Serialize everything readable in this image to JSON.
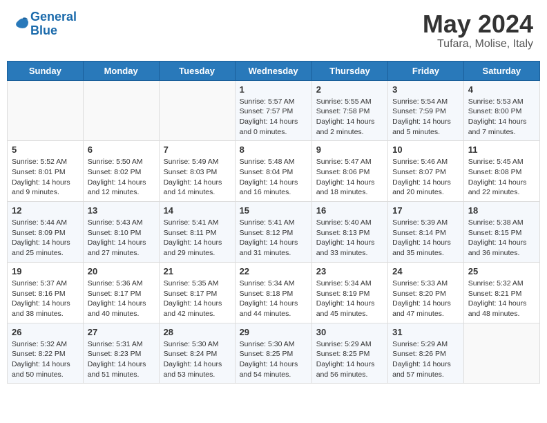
{
  "header": {
    "logo_line1": "General",
    "logo_line2": "Blue",
    "month": "May 2024",
    "location": "Tufara, Molise, Italy"
  },
  "days_of_week": [
    "Sunday",
    "Monday",
    "Tuesday",
    "Wednesday",
    "Thursday",
    "Friday",
    "Saturday"
  ],
  "weeks": [
    [
      {
        "day": "",
        "info": ""
      },
      {
        "day": "",
        "info": ""
      },
      {
        "day": "",
        "info": ""
      },
      {
        "day": "1",
        "info": "Sunrise: 5:57 AM\nSunset: 7:57 PM\nDaylight: 14 hours\nand 0 minutes."
      },
      {
        "day": "2",
        "info": "Sunrise: 5:55 AM\nSunset: 7:58 PM\nDaylight: 14 hours\nand 2 minutes."
      },
      {
        "day": "3",
        "info": "Sunrise: 5:54 AM\nSunset: 7:59 PM\nDaylight: 14 hours\nand 5 minutes."
      },
      {
        "day": "4",
        "info": "Sunrise: 5:53 AM\nSunset: 8:00 PM\nDaylight: 14 hours\nand 7 minutes."
      }
    ],
    [
      {
        "day": "5",
        "info": "Sunrise: 5:52 AM\nSunset: 8:01 PM\nDaylight: 14 hours\nand 9 minutes."
      },
      {
        "day": "6",
        "info": "Sunrise: 5:50 AM\nSunset: 8:02 PM\nDaylight: 14 hours\nand 12 minutes."
      },
      {
        "day": "7",
        "info": "Sunrise: 5:49 AM\nSunset: 8:03 PM\nDaylight: 14 hours\nand 14 minutes."
      },
      {
        "day": "8",
        "info": "Sunrise: 5:48 AM\nSunset: 8:04 PM\nDaylight: 14 hours\nand 16 minutes."
      },
      {
        "day": "9",
        "info": "Sunrise: 5:47 AM\nSunset: 8:06 PM\nDaylight: 14 hours\nand 18 minutes."
      },
      {
        "day": "10",
        "info": "Sunrise: 5:46 AM\nSunset: 8:07 PM\nDaylight: 14 hours\nand 20 minutes."
      },
      {
        "day": "11",
        "info": "Sunrise: 5:45 AM\nSunset: 8:08 PM\nDaylight: 14 hours\nand 22 minutes."
      }
    ],
    [
      {
        "day": "12",
        "info": "Sunrise: 5:44 AM\nSunset: 8:09 PM\nDaylight: 14 hours\nand 25 minutes."
      },
      {
        "day": "13",
        "info": "Sunrise: 5:43 AM\nSunset: 8:10 PM\nDaylight: 14 hours\nand 27 minutes."
      },
      {
        "day": "14",
        "info": "Sunrise: 5:41 AM\nSunset: 8:11 PM\nDaylight: 14 hours\nand 29 minutes."
      },
      {
        "day": "15",
        "info": "Sunrise: 5:41 AM\nSunset: 8:12 PM\nDaylight: 14 hours\nand 31 minutes."
      },
      {
        "day": "16",
        "info": "Sunrise: 5:40 AM\nSunset: 8:13 PM\nDaylight: 14 hours\nand 33 minutes."
      },
      {
        "day": "17",
        "info": "Sunrise: 5:39 AM\nSunset: 8:14 PM\nDaylight: 14 hours\nand 35 minutes."
      },
      {
        "day": "18",
        "info": "Sunrise: 5:38 AM\nSunset: 8:15 PM\nDaylight: 14 hours\nand 36 minutes."
      }
    ],
    [
      {
        "day": "19",
        "info": "Sunrise: 5:37 AM\nSunset: 8:16 PM\nDaylight: 14 hours\nand 38 minutes."
      },
      {
        "day": "20",
        "info": "Sunrise: 5:36 AM\nSunset: 8:17 PM\nDaylight: 14 hours\nand 40 minutes."
      },
      {
        "day": "21",
        "info": "Sunrise: 5:35 AM\nSunset: 8:17 PM\nDaylight: 14 hours\nand 42 minutes."
      },
      {
        "day": "22",
        "info": "Sunrise: 5:34 AM\nSunset: 8:18 PM\nDaylight: 14 hours\nand 44 minutes."
      },
      {
        "day": "23",
        "info": "Sunrise: 5:34 AM\nSunset: 8:19 PM\nDaylight: 14 hours\nand 45 minutes."
      },
      {
        "day": "24",
        "info": "Sunrise: 5:33 AM\nSunset: 8:20 PM\nDaylight: 14 hours\nand 47 minutes."
      },
      {
        "day": "25",
        "info": "Sunrise: 5:32 AM\nSunset: 8:21 PM\nDaylight: 14 hours\nand 48 minutes."
      }
    ],
    [
      {
        "day": "26",
        "info": "Sunrise: 5:32 AM\nSunset: 8:22 PM\nDaylight: 14 hours\nand 50 minutes."
      },
      {
        "day": "27",
        "info": "Sunrise: 5:31 AM\nSunset: 8:23 PM\nDaylight: 14 hours\nand 51 minutes."
      },
      {
        "day": "28",
        "info": "Sunrise: 5:30 AM\nSunset: 8:24 PM\nDaylight: 14 hours\nand 53 minutes."
      },
      {
        "day": "29",
        "info": "Sunrise: 5:30 AM\nSunset: 8:25 PM\nDaylight: 14 hours\nand 54 minutes."
      },
      {
        "day": "30",
        "info": "Sunrise: 5:29 AM\nSunset: 8:25 PM\nDaylight: 14 hours\nand 56 minutes."
      },
      {
        "day": "31",
        "info": "Sunrise: 5:29 AM\nSunset: 8:26 PM\nDaylight: 14 hours\nand 57 minutes."
      },
      {
        "day": "",
        "info": ""
      }
    ]
  ]
}
